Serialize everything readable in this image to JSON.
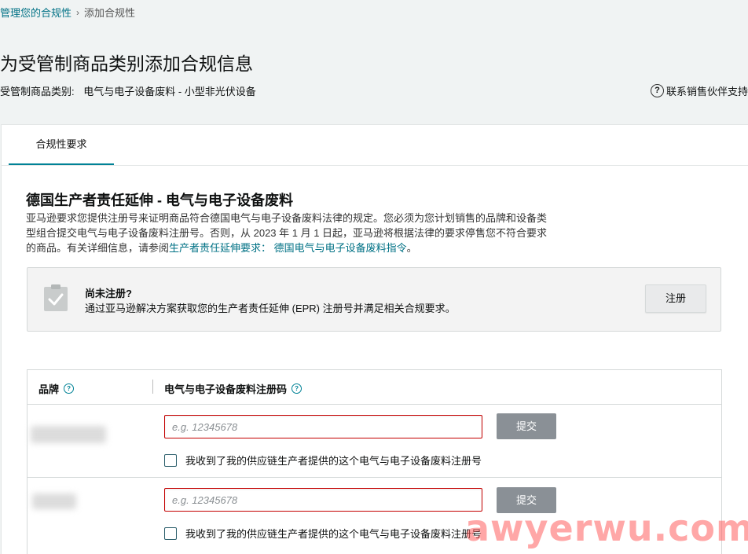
{
  "breadcrumb": {
    "parent": "管理您的合规性",
    "separator": "›",
    "current": "添加合规性"
  },
  "page": {
    "title": "为受管制商品类别添加合规信息",
    "category_label": "受管制商品类别:",
    "category_value": "电气与电子设备废料 - 小型非光伏设备",
    "help_link": "联系销售伙伴支持"
  },
  "tabs": [
    {
      "label": "合规性要求"
    }
  ],
  "section": {
    "title": "德国生产者责任延伸 - 电气与电子设备废料",
    "desc_part1": "亚马逊要求您提供注册号来证明商品符合德国电气与电子设备废料法律的规定。您必须为您计划销售的品牌和设备类型组合提交电气与电子设备废料注册号。否则，从 2023 年 1 月 1 日起，亚马逊将根据法律的要求停售您不符合要求的商品。有关详细信息，请参阅",
    "desc_link": "生产者责任延伸要求：  德国电气与电子设备废料指令",
    "desc_end": "。"
  },
  "notice": {
    "icon": "clipboard-check-icon",
    "title": "尚未注册?",
    "text": "通过亚马逊解决方案获取您的生产者责任延伸 (EPR) 注册号并满足相关合规要求。",
    "button": "注册"
  },
  "table": {
    "col_brand": "品牌",
    "col_reg": "电气与电子设备废料注册码",
    "rows": [
      {
        "placeholder": "e.g. 12345678",
        "submit": "提交",
        "checkbox_label": "我收到了我的供应链生产者提供的这个电气与电子设备废料注册号"
      },
      {
        "placeholder": "e.g. 12345678",
        "submit": "提交",
        "checkbox_label": "我收到了我的供应链生产者提供的这个电气与电子设备废料注册号"
      }
    ]
  },
  "watermark": "awyerwu.com",
  "colors": {
    "link": "#007185",
    "tab_underline": "#008296",
    "error_border": "#c40000",
    "submit_bg": "#8a9096"
  }
}
